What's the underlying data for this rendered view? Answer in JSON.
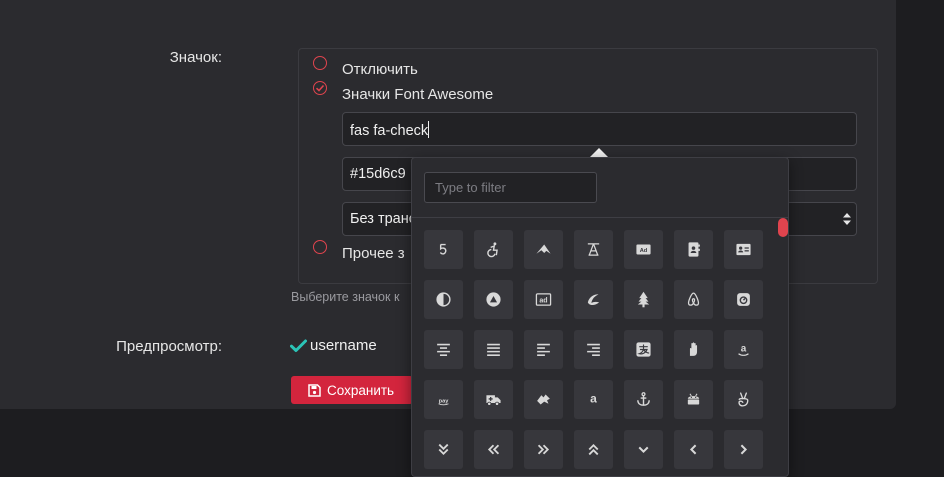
{
  "colors": {
    "accent": "#e0444e",
    "check": "#2bc4b7",
    "save": "#d3253d"
  },
  "icon_label": "Значок:",
  "options": {
    "disable_label": "Отключить",
    "fontawesome_label": "Значки Font Awesome",
    "icon_class_value": "fas fa-check",
    "color_value": "#15d6c9",
    "animation_value": "Без транс",
    "other_label": "Прочее з"
  },
  "hint": "Выберите значок к",
  "preview": {
    "label": "Предпросмотр:",
    "username": "username",
    "icon": "check-icon"
  },
  "save_label": "Сохранить",
  "picker": {
    "filter_placeholder": "Type to filter",
    "icons": [
      [
        "500px-icon",
        "accessible-icon-icon",
        "accusoft-icon",
        "acquisitions-incorporated-icon",
        "ad-icon",
        "address-book-icon",
        "address-card-icon"
      ],
      [
        "adjust-icon",
        "adn-icon",
        "adversal-icon",
        "affiliatetheme-icon",
        "air-freshener-icon",
        "airbnb-icon",
        "algolia-icon"
      ],
      [
        "align-center-icon",
        "align-justify-icon",
        "align-left-icon",
        "align-right-icon",
        "alipay-icon",
        "allergies-icon",
        "amazon-icon"
      ],
      [
        "amazon-pay-icon",
        "ambulance-icon",
        "american-sign-language-icon",
        "amilia-icon",
        "anchor-icon",
        "android-icon",
        "angellist-icon"
      ],
      [
        "angle-double-down-icon",
        "angle-double-left-icon",
        "angle-double-right-icon",
        "angle-double-up-icon",
        "angle-down-icon",
        "angle-left-icon",
        "angle-right-icon"
      ]
    ],
    "icon_text": {
      "ad": "Ad",
      "adversal": "ad",
      "amazon_pay": "pay",
      "amilia": "a"
    }
  }
}
